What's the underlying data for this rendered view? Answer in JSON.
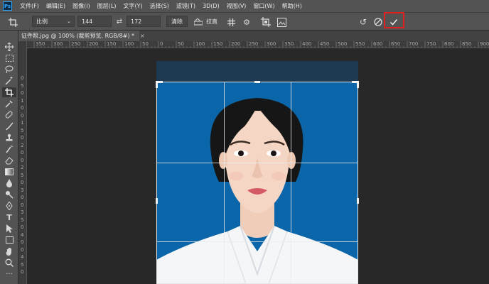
{
  "menubar": {
    "logo": "Ps",
    "items": [
      "文件(F)",
      "编辑(E)",
      "图像(I)",
      "图层(L)",
      "文字(Y)",
      "选择(S)",
      "滤镜(T)",
      "3D(D)",
      "视图(V)",
      "窗口(W)",
      "帮助(H)"
    ]
  },
  "options": {
    "ratio_label": "比例",
    "width_value": "144",
    "height_value": "172",
    "clear_label": "清除",
    "straighten_label": "拉直"
  },
  "document": {
    "tab_title": "证件照.jpg @ 100% (裁剪预览, RGB/8#) *",
    "close": "×"
  },
  "ruler": {
    "top_labels": [
      "350",
      "300",
      "250",
      "200",
      "150",
      "100",
      "50",
      "0",
      "50",
      "100",
      "150",
      "200",
      "250",
      "300",
      "350",
      "400",
      "450",
      "500",
      "550",
      "600",
      "650",
      "700",
      "750",
      "800",
      "850",
      "900"
    ],
    "left_labels": [
      "0",
      "5",
      "0",
      "1",
      "0",
      "0",
      "1",
      "5",
      "0",
      "2",
      "0",
      "0",
      "2",
      "5",
      "0",
      "3",
      "0",
      "0",
      "3",
      "5",
      "0",
      "4",
      "0",
      "0",
      "4",
      "5",
      "0"
    ]
  },
  "icons": {
    "crop_tool": "crop-icon",
    "reset": "undo-icon",
    "cancel": "cancel-icon",
    "commit": "check-icon"
  },
  "colors": {
    "background_blue": "#0a66a8",
    "commit_highlight": "#e02020"
  }
}
